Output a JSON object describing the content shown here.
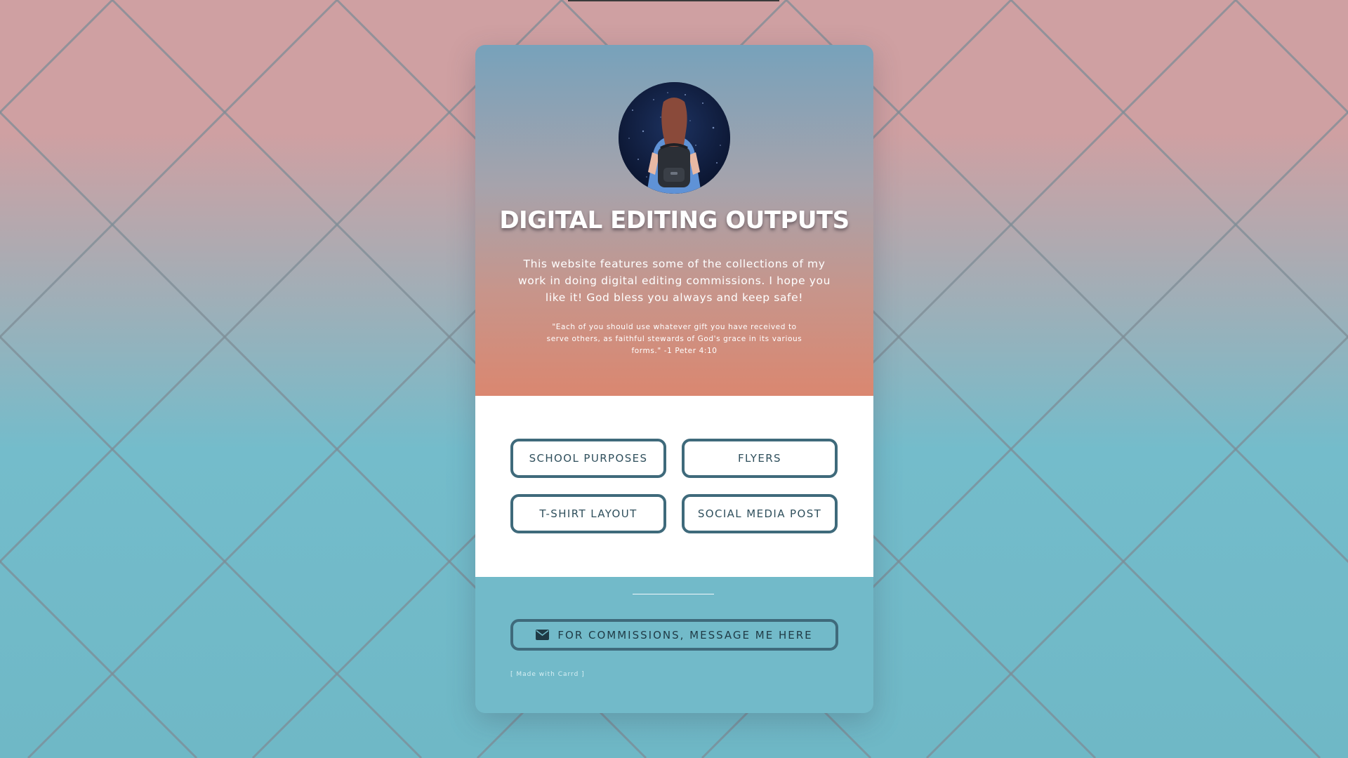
{
  "colors": {
    "background_top": "#cfa0a2",
    "background_bottom": "#6fb8c6",
    "hero_top": "#77a2bb",
    "hero_bottom": "#da8770",
    "button_border": "#3f6a7b",
    "footer_bg": "#72bac9"
  },
  "profile": {
    "avatar_icon": "girl-with-backpack-illustration",
    "title": "DIGITAL EDITING OUTPUTS",
    "description": "This website features some of the collections of my work in doing digital editing commissions. I hope you like it! God bless you always and keep safe!",
    "quote": "\"Each of you should use whatever gift you have received to serve others, as faithful stewards of God's grace in its various forms.\" -1 Peter 4:10"
  },
  "links": {
    "school_purposes": "SCHOOL PURPOSES",
    "flyers": "FLYERS",
    "tshirt_layout": "T-SHIRT LAYOUT",
    "social_media_post": "SOCIAL MEDIA POST"
  },
  "footer": {
    "contact_icon": "envelope-icon",
    "contact_label": "FOR COMMISSIONS, MESSAGE ME HERE",
    "made_with": "[ Made with Carrd ]"
  }
}
